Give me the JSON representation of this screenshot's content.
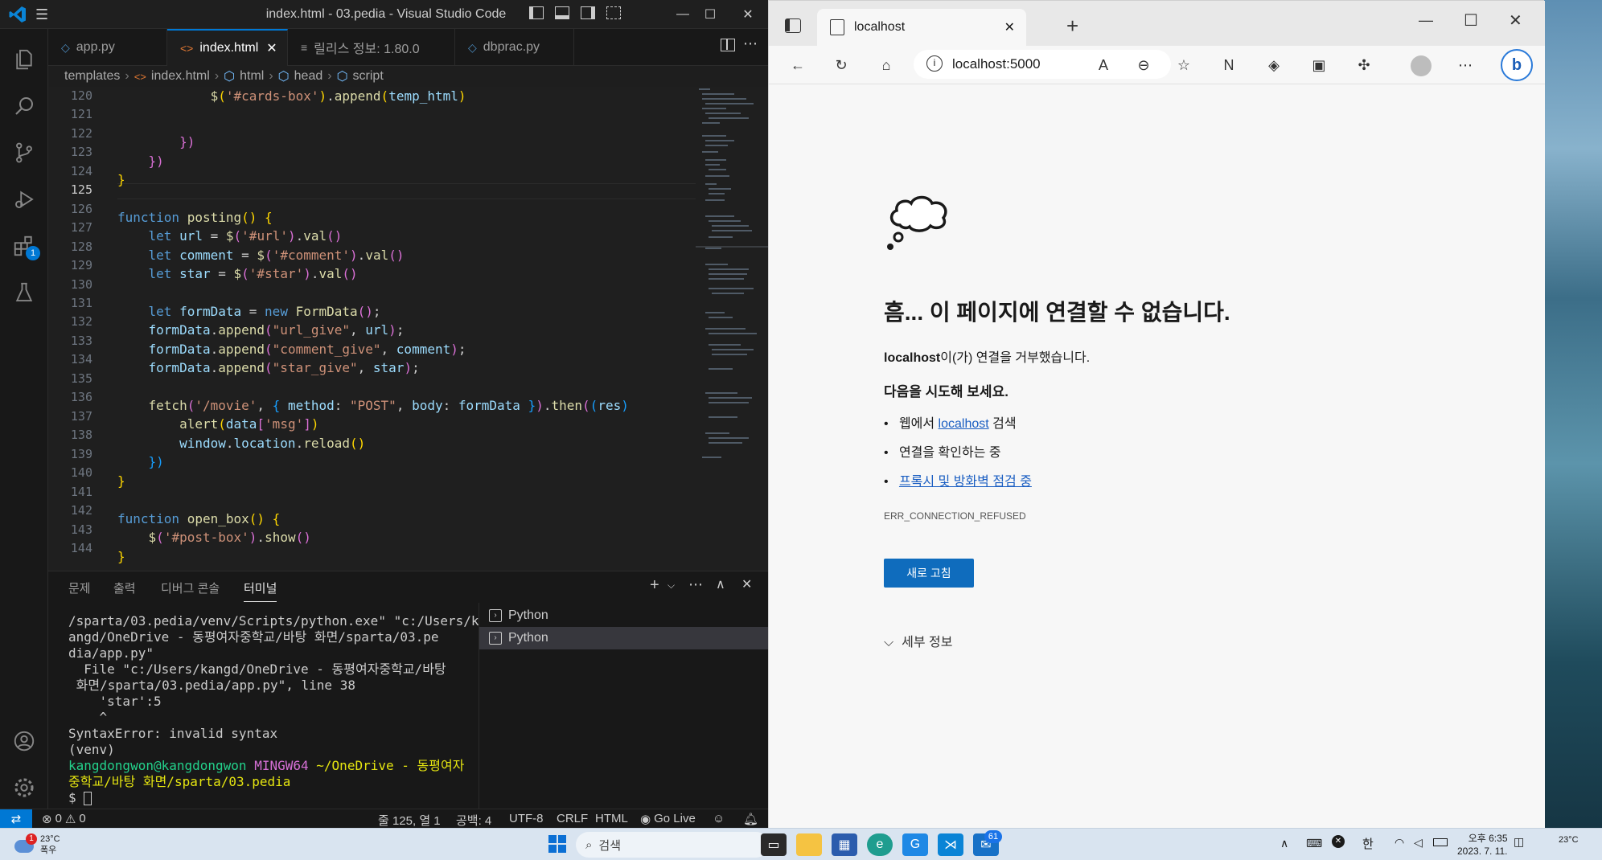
{
  "vscode": {
    "window_title": "index.html - 03.pedia - Visual Studio Code",
    "activity_badge": "1",
    "tabs": [
      {
        "icon": "◇",
        "label": "app.py"
      },
      {
        "icon": "<>",
        "label": "index.html",
        "close": "✕"
      },
      {
        "icon": "≡",
        "label": "릴리스 정보: 1.80.0"
      },
      {
        "icon": "◇",
        "label": "dbprac.py"
      }
    ],
    "breadcrumb": [
      "templates",
      "index.html",
      "html",
      "head",
      "script"
    ],
    "line_numbers": [
      "120",
      "121",
      "122",
      "123",
      "124",
      "125",
      "126",
      "127",
      "128",
      "129",
      "130",
      "131",
      "132",
      "133",
      "134",
      "135",
      "136",
      "137",
      "138",
      "139",
      "140",
      "141",
      "142",
      "143",
      "144"
    ],
    "panel_tabs": [
      "문제",
      "출력",
      "디버그 콘솔",
      "터미널"
    ],
    "terminal_lines": [
      "/sparta/03.pedia/venv/Scripts/python.exe\" \"c:/Users/k",
      "angd/OneDrive - 동평여자중학교/바탕 화면/sparta/03.pe",
      "dia/app.py\"",
      "  File \"c:/Users/kangd/OneDrive - 동평여자중학교/바탕",
      " 화면/sparta/03.pedia/app.py\", line 38",
      "    'star':5",
      "    ^",
      "SyntaxError: invalid syntax",
      "(venv)"
    ],
    "prompt_user": "kangdongwon@kangdongwon",
    "prompt_host": "MINGW64",
    "prompt_path_1": "~/OneDrive - 동평여자",
    "prompt_path_2": "중학교/바탕 화면/sparta/03.pedia",
    "prompt_symbol": "$",
    "terminal_list": [
      "Python",
      "Python"
    ],
    "status": {
      "errors": "0",
      "warnings": "0",
      "position": "줄 125, 열 1",
      "spaces": "공백: 4",
      "encoding": "UTF-8",
      "eol": "CRLF",
      "language": "HTML",
      "golive": "Go Live"
    }
  },
  "edge": {
    "tab_title": "localhost",
    "address": "localhost:5000",
    "error_title": "흠... 이 페이지에 연결할 수 없습니다.",
    "error_host": "localhost",
    "error_msg_rest": "이(가) 연결을 거부했습니다.",
    "try_heading": "다음을 시도해 보세요.",
    "suggest_1_pre": "웹에서 ",
    "suggest_1_link": "localhost",
    "suggest_1_post": " 검색",
    "suggest_2": "연결을 확인하는 중",
    "suggest_3_link": "프록시 및 방화벽 점검 중",
    "error_code": "ERR_CONNECTION_REFUSED",
    "reload_label": "새로 고침",
    "details_label": "세부 정보"
  },
  "taskbar": {
    "weather_temp": "23°C",
    "weather_desc": "폭우",
    "search_placeholder": "검색",
    "edge_badge": "61",
    "ime": "한",
    "time": "오후 6:35",
    "date": "2023. 7. 11.",
    "right_temp": "23°C"
  }
}
